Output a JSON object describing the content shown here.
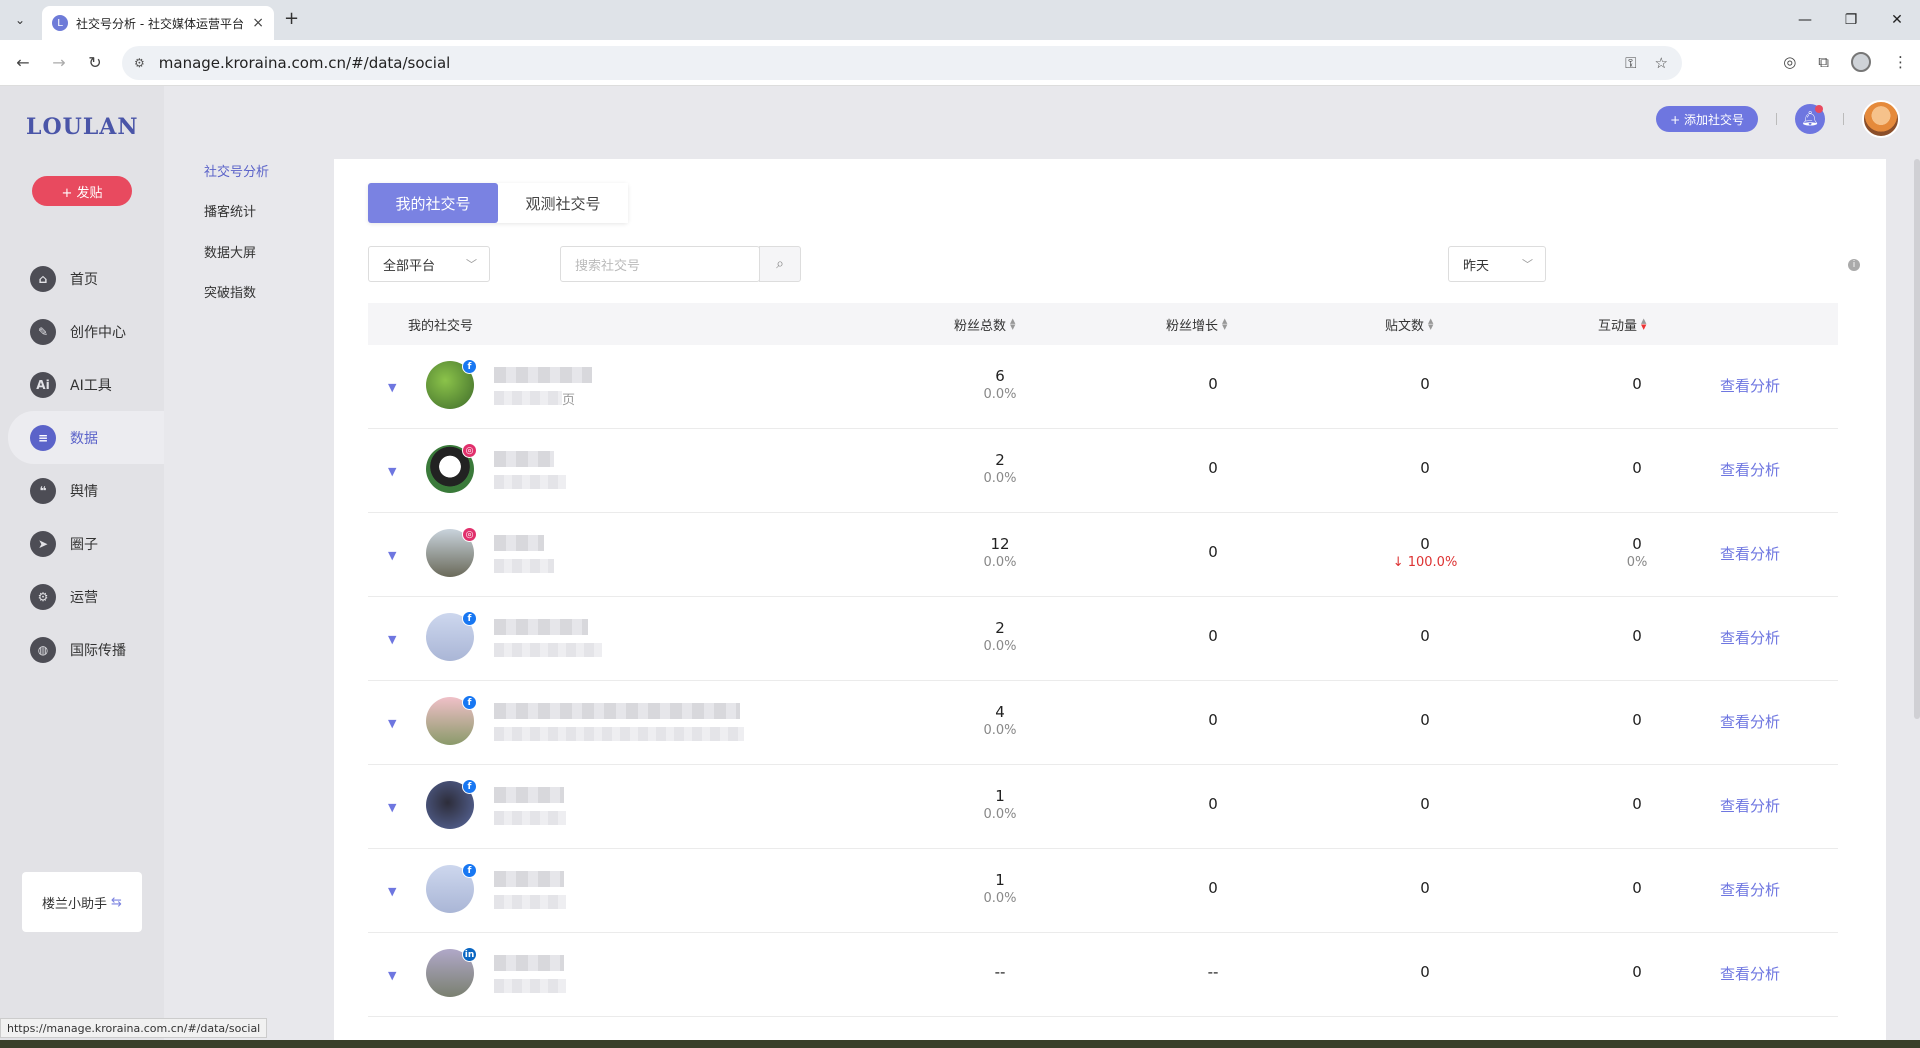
{
  "browser": {
    "tab_title": "社交号分析 - 社交媒体运营平台",
    "tab_favicon": "L",
    "new_tab": "+",
    "close_tab": "×",
    "url": "manage.kroraina.com.cn/#/data/social",
    "status_url": "https://manage.kroraina.com.cn/#/data/social"
  },
  "sidebar": {
    "logo": "LOULAN",
    "post_button": "+ 发贴",
    "items": [
      {
        "label": "首页",
        "icon": "home-icon",
        "glyph": "⌂"
      },
      {
        "label": "创作中心",
        "icon": "palette-icon",
        "glyph": "✎"
      },
      {
        "label": "AI工具",
        "icon": "ai-icon",
        "glyph": "Ai"
      },
      {
        "label": "数据",
        "icon": "database-icon",
        "glyph": "≡"
      },
      {
        "label": "舆情",
        "icon": "quote-icon",
        "glyph": "❝"
      },
      {
        "label": "圈子",
        "icon": "compass-icon",
        "glyph": "➤"
      },
      {
        "label": "运营",
        "icon": "operation-icon",
        "glyph": "⚙"
      },
      {
        "label": "国际传播",
        "icon": "globe-icon",
        "glyph": "◍"
      }
    ],
    "active_index": 3,
    "helper": "楼兰小助手"
  },
  "subnav": {
    "items": [
      "社交号分析",
      "播客统计",
      "数据大屏",
      "突破指数"
    ],
    "active_index": 0
  },
  "header": {
    "add_social": "+ 添加社交号"
  },
  "tabs": [
    "我的社交号",
    "观测社交号"
  ],
  "filters": {
    "platform": "全部平台",
    "search_placeholder": "搜索社交号",
    "date": "昨天"
  },
  "table": {
    "columns": [
      "我的社交号",
      "粉丝总数",
      "粉丝增长",
      "贴文数",
      "互动量"
    ],
    "action_label": "查看分析",
    "rows": [
      {
        "platform": "facebook",
        "badge": "f",
        "followers": "6",
        "followers_pct": "0.0%",
        "growth": "0",
        "posts": "0",
        "posts_pct": "",
        "engagement": "0",
        "engagement_pct": "",
        "suffix": "页"
      },
      {
        "platform": "instagram",
        "badge": "◎",
        "followers": "2",
        "followers_pct": "0.0%",
        "growth": "0",
        "posts": "0",
        "posts_pct": "",
        "engagement": "0",
        "engagement_pct": "",
        "suffix": ""
      },
      {
        "platform": "instagram",
        "badge": "◎",
        "followers": "12",
        "followers_pct": "0.0%",
        "growth": "0",
        "posts": "0",
        "posts_pct": "↓ 100.0%",
        "engagement": "0",
        "engagement_pct": "0%",
        "suffix": ""
      },
      {
        "platform": "facebook",
        "badge": "f",
        "followers": "2",
        "followers_pct": "0.0%",
        "growth": "0",
        "posts": "0",
        "posts_pct": "",
        "engagement": "0",
        "engagement_pct": "",
        "suffix": ""
      },
      {
        "platform": "facebook",
        "badge": "f",
        "followers": "4",
        "followers_pct": "0.0%",
        "growth": "0",
        "posts": "0",
        "posts_pct": "",
        "engagement": "0",
        "engagement_pct": "",
        "suffix": ""
      },
      {
        "platform": "facebook",
        "badge": "f",
        "followers": "1",
        "followers_pct": "0.0%",
        "growth": "0",
        "posts": "0",
        "posts_pct": "",
        "engagement": "0",
        "engagement_pct": "",
        "suffix": ""
      },
      {
        "platform": "facebook",
        "badge": "f",
        "followers": "1",
        "followers_pct": "0.0%",
        "growth": "0",
        "posts": "0",
        "posts_pct": "",
        "engagement": "0",
        "engagement_pct": "",
        "suffix": ""
      },
      {
        "platform": "linkedin",
        "badge": "in",
        "followers": "--",
        "followers_pct": "",
        "growth": "--",
        "posts": "0",
        "posts_pct": "",
        "engagement": "0",
        "engagement_pct": "",
        "suffix": ""
      }
    ]
  },
  "colors": {
    "accent": "#6e76e0",
    "post_button": "#e84a5f",
    "facebook": "#1877f2",
    "instagram": "#e1306c",
    "linkedin": "#0a66c2",
    "down": "#dd3333"
  }
}
